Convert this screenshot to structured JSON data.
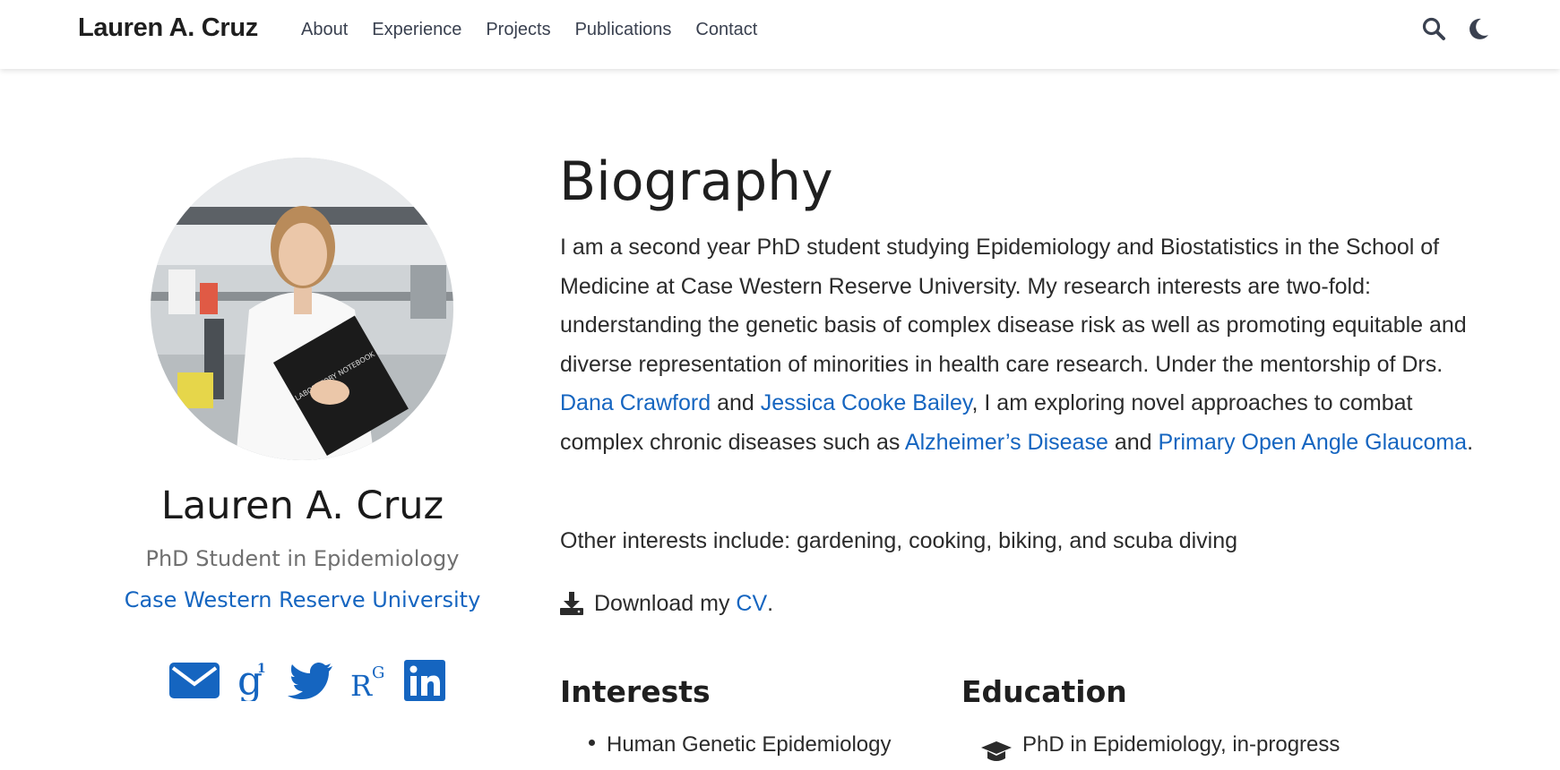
{
  "nav": {
    "brand": "Lauren A. Cruz",
    "links": [
      "About",
      "Experience",
      "Projects",
      "Publications",
      "Contact"
    ]
  },
  "profile": {
    "name": "Lauren A. Cruz",
    "role": "PhD Student in Epidemiology",
    "organization": "Case Western Reserve University",
    "photo_text": "LABORATORY NOTEBOOK",
    "social_icons": [
      "envelope-icon",
      "google-scholar-icon",
      "twitter-icon",
      "researchgate-icon",
      "linkedin-icon"
    ]
  },
  "biography": {
    "title": "Biography",
    "p1": "I am a second year PhD student studying Epidemiology and Biostatistics in the School of Medicine at Case Western Reserve University. My research interests are two-fold: understanding the genetic basis of complex disease risk as well as promoting equitable and diverse representation of minorities in health care research. Under the mentorship of Drs. ",
    "link_crawford": "Dana Crawford",
    "and1": " and ",
    "link_bailey": "Jessica Cooke Bailey",
    "p1b": ", I am exploring novel approaches to combat complex chronic diseases such as ",
    "link_alz": "Alzheimer’s Disease",
    "and2": " and ",
    "link_glaucoma": "Primary Open Angle Glaucoma",
    "period": ".",
    "other": "Other interests include: gardening, cooking, biking, and scuba diving",
    "cv_prefix": "Download my ",
    "cv_link": "CV",
    "cv_suffix": "."
  },
  "interests": {
    "title": "Interests",
    "items": [
      "Human Genetic Epidemiology"
    ]
  },
  "education": {
    "title": "Education",
    "items": [
      "PhD in Epidemiology, in-progress"
    ]
  },
  "colors": {
    "link": "#1565c0",
    "text": "#2b2b2b"
  }
}
